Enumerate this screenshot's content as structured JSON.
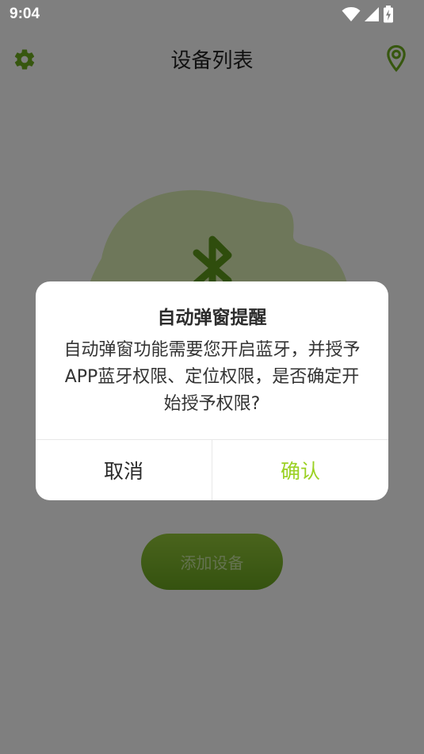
{
  "status_bar": {
    "time": "9:04",
    "icons": [
      "wifi-icon",
      "signal-icon",
      "battery-charging-icon"
    ]
  },
  "app_bar": {
    "title": "设备列表",
    "left_icon": "gear-icon",
    "right_icon": "location-pin-icon"
  },
  "main": {
    "illustration_icon": "bluetooth-icon",
    "add_device_label": "添加设备"
  },
  "dialog": {
    "title": "自动弹窗提醒",
    "message": "自动弹窗功能需要您开启蓝牙，并授予APP蓝牙权限、定位权限，是否确定开始授予权限?",
    "cancel_label": "取消",
    "confirm_label": "确认"
  },
  "colors": {
    "accent": "#9bd124",
    "icon_green": "#5f9a1b",
    "scrim": "rgba(0,0,0,0.5)"
  }
}
